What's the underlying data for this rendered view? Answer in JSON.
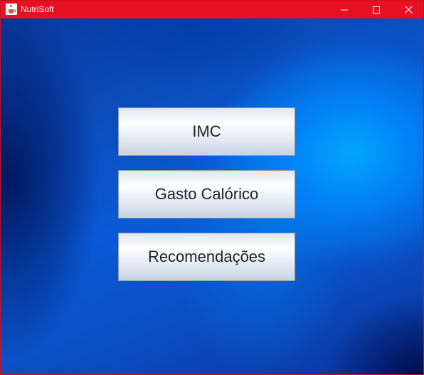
{
  "window": {
    "title": "NutriSoft",
    "icon": "java-cup-icon",
    "titlebar_color": "#e81123",
    "controls": {
      "minimize_icon": "minimize-icon",
      "maximize_icon": "maximize-icon",
      "close_icon": "close-icon"
    }
  },
  "menu": {
    "buttons": [
      {
        "label": "IMC"
      },
      {
        "label": "Gasto Calórico"
      },
      {
        "label": "Recomendações"
      }
    ]
  },
  "colors": {
    "background_light": "#0096ff",
    "background_dark": "#001a66",
    "button_text": "#222222"
  }
}
